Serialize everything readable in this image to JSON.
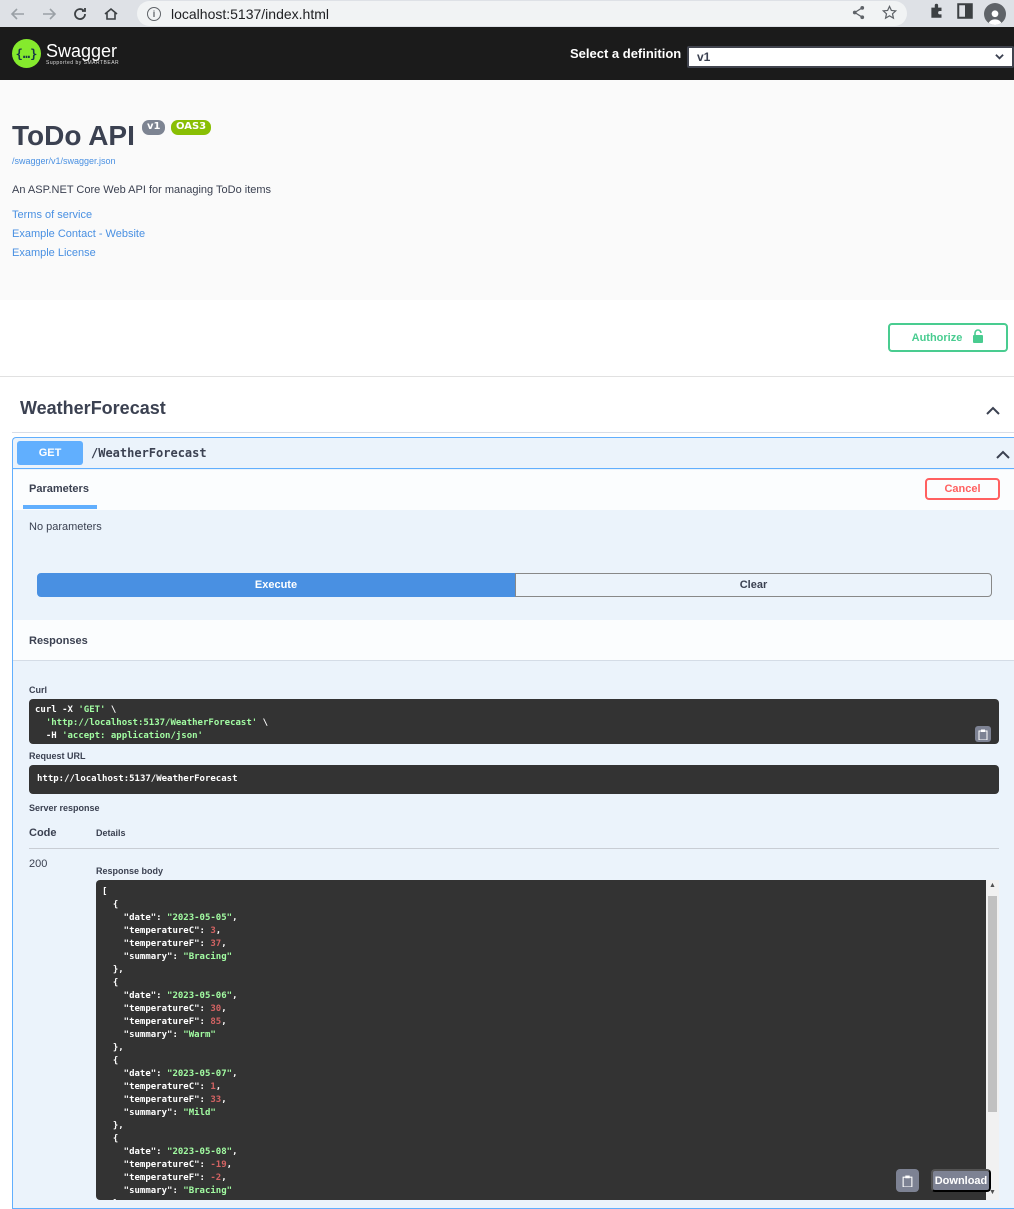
{
  "browser": {
    "url": "localhost:5137/index.html"
  },
  "topbar": {
    "logo_title": "Swagger",
    "logo_subtitle": "Supported by SMARTBEAR",
    "definition_label": "Select a definition",
    "definition_value": "v1"
  },
  "info": {
    "title": "ToDo API",
    "version_badge": "v1",
    "oas_badge": "OAS3",
    "spec_link": "/swagger/v1/swagger.json",
    "description": "An ASP.NET Core Web API for managing ToDo items",
    "links": [
      "Terms of service",
      "Example Contact - Website",
      "Example License"
    ]
  },
  "authorize_label": "Authorize",
  "tag": {
    "title": "WeatherForecast"
  },
  "operation": {
    "method": "GET",
    "path": "/WeatherForecast",
    "parameters_tab": "Parameters",
    "cancel_label": "Cancel",
    "no_params": "No parameters",
    "execute_label": "Execute",
    "clear_label": "Clear",
    "responses_label": "Responses",
    "curl_label": "Curl",
    "curl_lines": [
      "curl -X 'GET' \\",
      "'http://localhost:5137/WeatherForecast' \\",
      "-H 'accept: application/json'"
    ],
    "request_url_label": "Request URL",
    "request_url": "http://localhost:5137/WeatherForecast",
    "server_response_label": "Server response",
    "code_header": "Code",
    "details_header": "Details",
    "status_code": "200",
    "response_body_label": "Response body",
    "download_label": "Download",
    "response_items": [
      {
        "date": "2023-05-05",
        "temperatureC": "3",
        "temperatureF": "37",
        "summary": "Bracing"
      },
      {
        "date": "2023-05-06",
        "temperatureC": "30",
        "temperatureF": "85",
        "summary": "Warm"
      },
      {
        "date": "2023-05-07",
        "temperatureC": "1",
        "temperatureF": "33",
        "summary": "Mild"
      },
      {
        "date": "2023-05-08",
        "temperatureC": "-19",
        "temperatureF": "-2",
        "summary": "Bracing"
      }
    ]
  }
}
